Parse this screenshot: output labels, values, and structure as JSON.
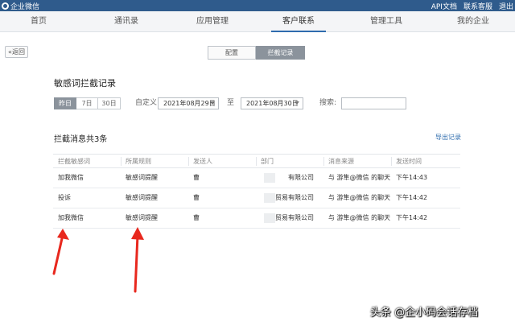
{
  "topbar": {
    "brand": "企业微信",
    "links": [
      "API文档",
      "联系客服",
      "退出"
    ]
  },
  "nav": {
    "items": [
      "首页",
      "通讯录",
      "应用管理",
      "客户联系",
      "管理工具",
      "我的企业"
    ],
    "active": "客户联系"
  },
  "back_button": "返回",
  "subtabs": [
    "配置",
    "拦截记录"
  ],
  "page_title": "敏感词拦截记录",
  "filter": {
    "ranges": [
      "昨日",
      "7日",
      "30日"
    ],
    "custom_label": "自定义",
    "start_date": "2021年08月29日",
    "to_label": "至",
    "end_date": "2021年08月30日",
    "search_label": "搜索:",
    "search_value": ""
  },
  "summary": "拦截消息共3条",
  "export_label": "导出记录",
  "table": {
    "headers": [
      "拦截敏感词",
      "所属规则",
      "发送人",
      "部门",
      "消息来源",
      "发送时间"
    ],
    "rows": [
      [
        "加我微信",
        "敏感词提醒",
        "曹",
        "有限公司",
        "与 游隼@微信 的聊天",
        "下午14:43"
      ],
      [
        "投诉",
        "敏感词提醒",
        "曹",
        "贸易有限公司",
        "与 游隼@微信 的聊天",
        "下午14:42"
      ],
      [
        "加我微信",
        "敏感词提醒",
        "曹",
        "贸易有限公司",
        "与 游隼@微信 的聊天",
        "下午14:42"
      ]
    ]
  },
  "watermark": "头条 @企小码会话存档",
  "colors": {
    "topbar": "#2f5b8c",
    "accent": "#2f6cae",
    "active_segment": "#8b939c",
    "arrow": "#e8281e"
  }
}
